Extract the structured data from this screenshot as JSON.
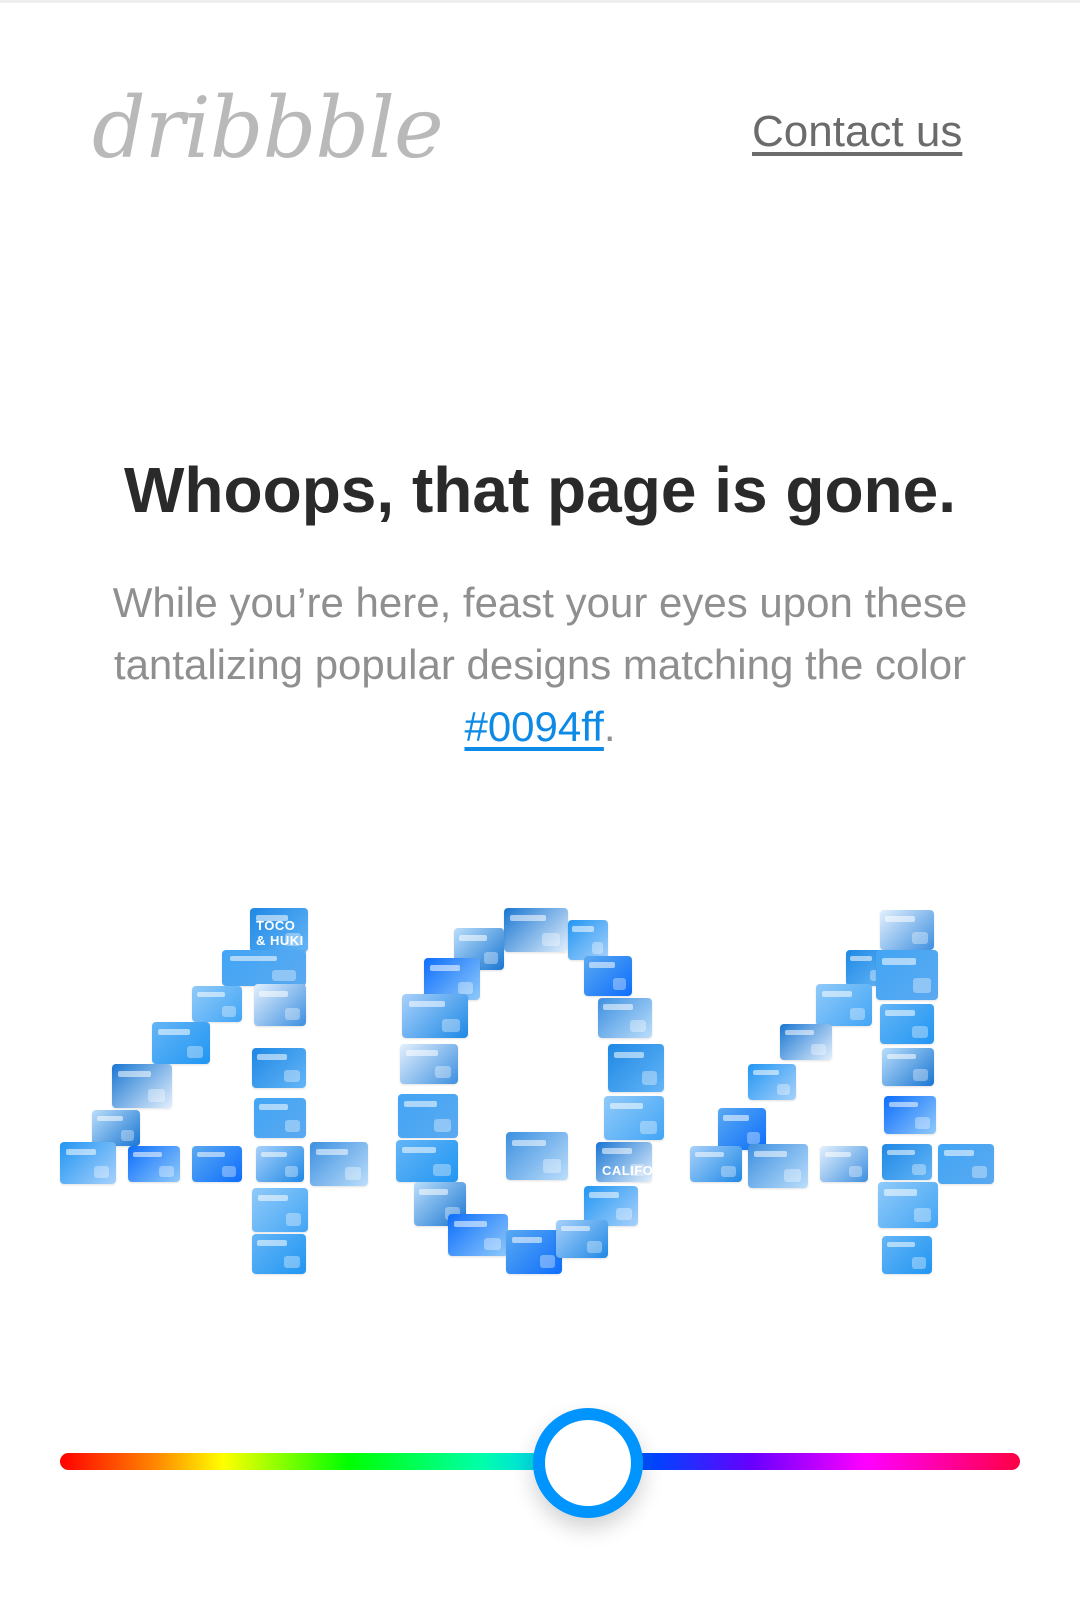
{
  "header": {
    "logo_text": "dribbble",
    "contact_label": "Contact us"
  },
  "main": {
    "headline": "Whoops, that page is gone.",
    "sub_before": "While you’re here, feast your eyes upon these tantalizing popular designs matching the color ",
    "color_link": "#0094ff",
    "sub_after": "."
  },
  "mosaic": {
    "tile_labels": [
      "TOCO & HUKI",
      "CALIFORNIA"
    ]
  },
  "slider": {
    "selected_color": "#0094ff",
    "value_fraction": 0.55
  },
  "colors": {
    "accent": "#0094ff",
    "link": "#0d8ae6",
    "logo": "#b9b9b9",
    "headline": "#2a2a2a",
    "body_text": "#8f8f8f"
  }
}
